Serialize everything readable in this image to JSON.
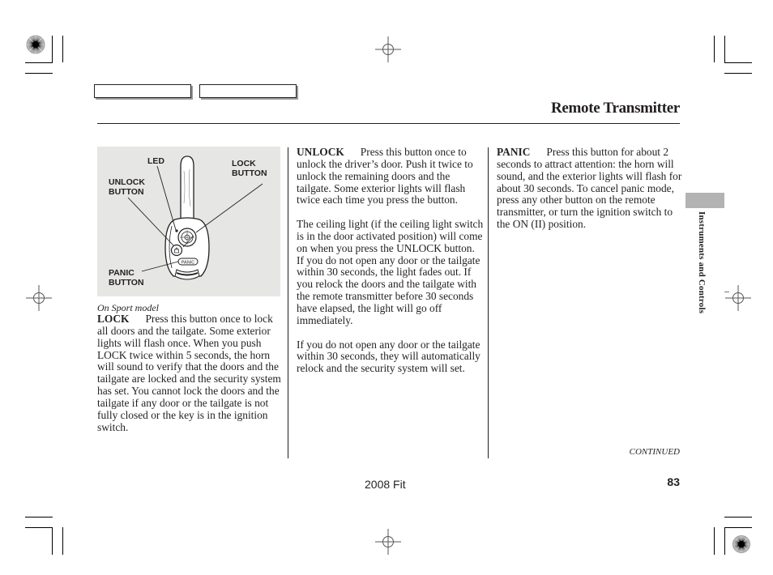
{
  "header": {
    "title": "Remote Transmitter"
  },
  "figure": {
    "caption": "On Sport model",
    "labels": {
      "led": "LED",
      "lock_button": [
        "LOCK",
        "BUTTON"
      ],
      "unlock_button": [
        "UNLOCK",
        "BUTTON"
      ],
      "panic_button": [
        "PANIC",
        "BUTTON"
      ],
      "panic_key_text": "PANIC"
    }
  },
  "columns": {
    "lock": {
      "lead": "LOCK",
      "text": "Press this button once to lock all doors and the tailgate. Some exterior lights will flash once. When you push LOCK twice within 5 seconds, the horn will sound to verify that the doors and the tailgate are locked and the security system has set. You cannot lock the doors and the tailgate if any door or the tailgate is not fully closed or the key is in the ignition switch."
    },
    "unlock": {
      "lead": "UNLOCK",
      "text": "Press this button once to unlock the driver’s door. Push it twice to unlock the remaining doors and the tailgate. Some exterior lights will flash twice each time you press the button.",
      "para2": "The ceiling light (if the ceiling light switch is in the door activated position) will come on when you press the UNLOCK button. If you do not open any door or the tailgate within 30 seconds, the light fades out. If you relock the doors and the tailgate with the remote transmitter before 30 seconds have elapsed, the light will go off immediately.",
      "para3": "If you do not open any door or the tailgate within 30 seconds, they will automatically relock and the security system will set."
    },
    "panic": {
      "lead": "PANIC",
      "text": "Press this button for about 2 seconds to attract attention: the horn will sound, and the exterior lights will flash for about 30 seconds. To cancel panic mode, press any other button on the remote transmitter, or turn the ignition switch to the ON (II) position."
    }
  },
  "side_tab": {
    "label": "Instruments and Controls"
  },
  "footer": {
    "continued": "CONTINUED",
    "model": "2008  Fit",
    "page_number": "83"
  }
}
